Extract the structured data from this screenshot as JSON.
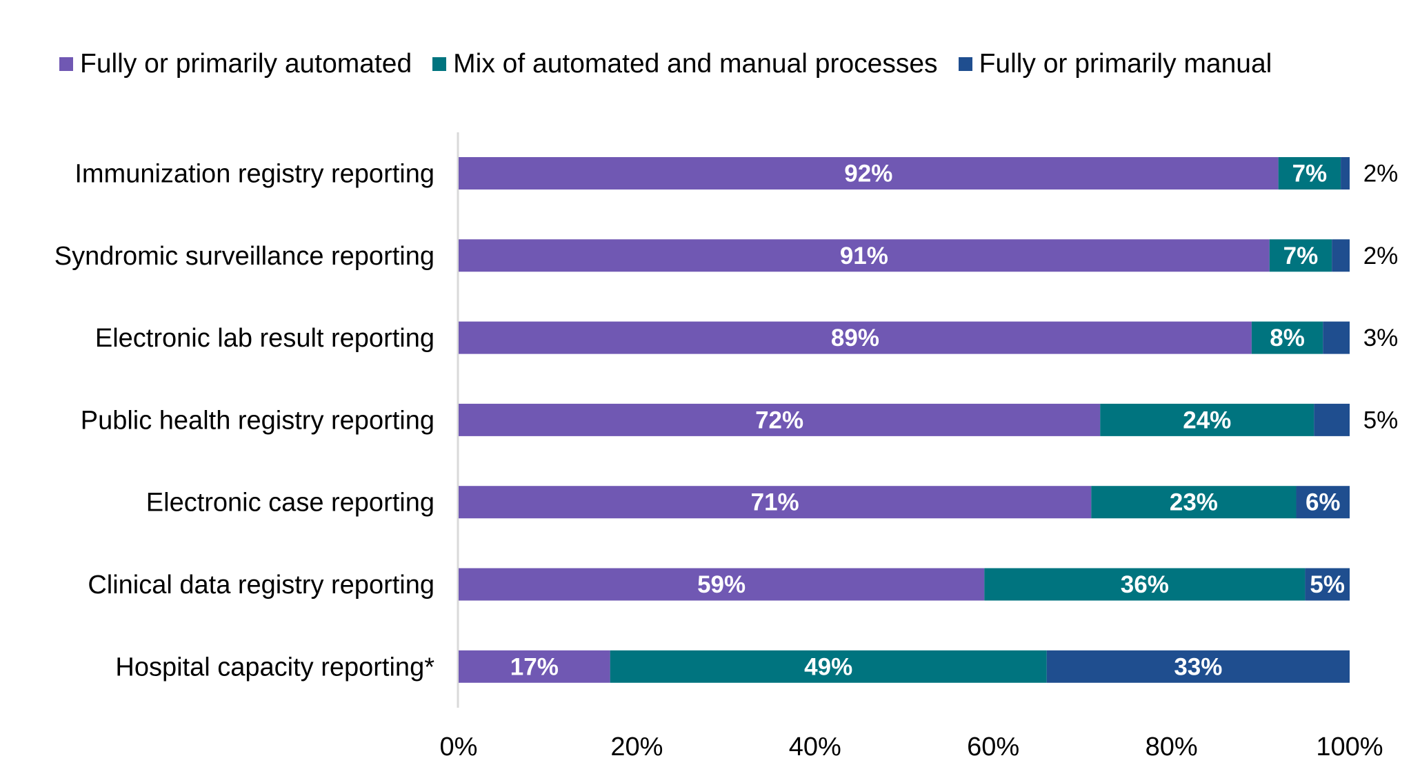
{
  "chart_data": {
    "type": "bar",
    "orientation": "horizontal",
    "stacked": true,
    "title": "",
    "xlabel": "",
    "ylabel": "",
    "xlim": [
      0,
      100
    ],
    "x_ticks": [
      "0%",
      "20%",
      "40%",
      "60%",
      "80%",
      "100%"
    ],
    "grid": false,
    "legend_position": "top",
    "categories": [
      "Immunization registry reporting",
      "Syndromic surveillance reporting",
      "Electronic lab result reporting",
      "Public health registry reporting",
      "Electronic case reporting",
      "Clinical data registry reporting",
      "Hospital capacity reporting*"
    ],
    "series": [
      {
        "name": "Fully or primarily automated",
        "color": "#7058B3",
        "values": [
          92,
          91,
          89,
          72,
          71,
          59,
          17
        ]
      },
      {
        "name": "Mix of automated and manual processes",
        "color": "#00747F",
        "values": [
          7,
          7,
          8,
          24,
          23,
          36,
          49
        ]
      },
      {
        "name": "Fully or primarily manual",
        "color": "#1F4E8F",
        "values": [
          2,
          2,
          3,
          5,
          6,
          5,
          33
        ]
      }
    ],
    "data_labels": [
      [
        "92%",
        "7%",
        "2%"
      ],
      [
        "91%",
        "7%",
        "2%"
      ],
      [
        "89%",
        "8%",
        "3%"
      ],
      [
        "72%",
        "24%",
        "5%"
      ],
      [
        "71%",
        "23%",
        "6%"
      ],
      [
        "59%",
        "36%",
        "5%"
      ],
      [
        "17%",
        "49%",
        "33%"
      ]
    ]
  }
}
